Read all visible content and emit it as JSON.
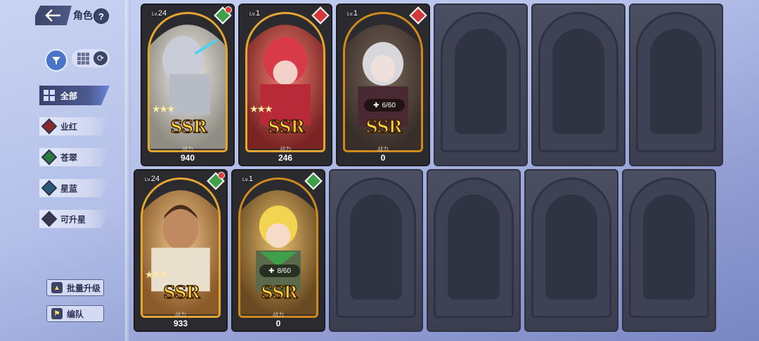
{
  "header": {
    "title": "角色",
    "help": "?"
  },
  "categories": [
    {
      "label": "全部",
      "color": "#4a74c9"
    },
    {
      "label": "业红",
      "color": "#8a2a2a"
    },
    {
      "label": "苍翠",
      "color": "#2e7a3c"
    },
    {
      "label": "星蓝",
      "color": "#2a5a7a"
    },
    {
      "label": "可升星",
      "color": "#3a3a4a"
    }
  ],
  "buttons": {
    "batch_upgrade": "批量升级",
    "formation": "编队"
  },
  "cards": [
    {
      "level": "24",
      "rank": "SSR",
      "power_label": "战力",
      "power": "940",
      "element_color": "#3fa04a",
      "stars": "★★★"
    },
    {
      "level": "1",
      "rank": "SSR",
      "power_label": "战力",
      "power": "246",
      "element_color": "#d23a3a",
      "stars": "★★★"
    },
    {
      "level": "1",
      "rank": "SSR",
      "power_label": "战力",
      "power": "0",
      "element_color": "#d23a3a",
      "shards": "6/60"
    },
    {
      "level": "24",
      "rank": "SSR",
      "power_label": "战力",
      "power": "933",
      "element_color": "#3fa04a",
      "stars": "★★★"
    },
    {
      "level": "1",
      "rank": "SSR",
      "power_label": "战力",
      "power": "0",
      "element_color": "#3fa04a",
      "shards": "8/60"
    }
  ]
}
